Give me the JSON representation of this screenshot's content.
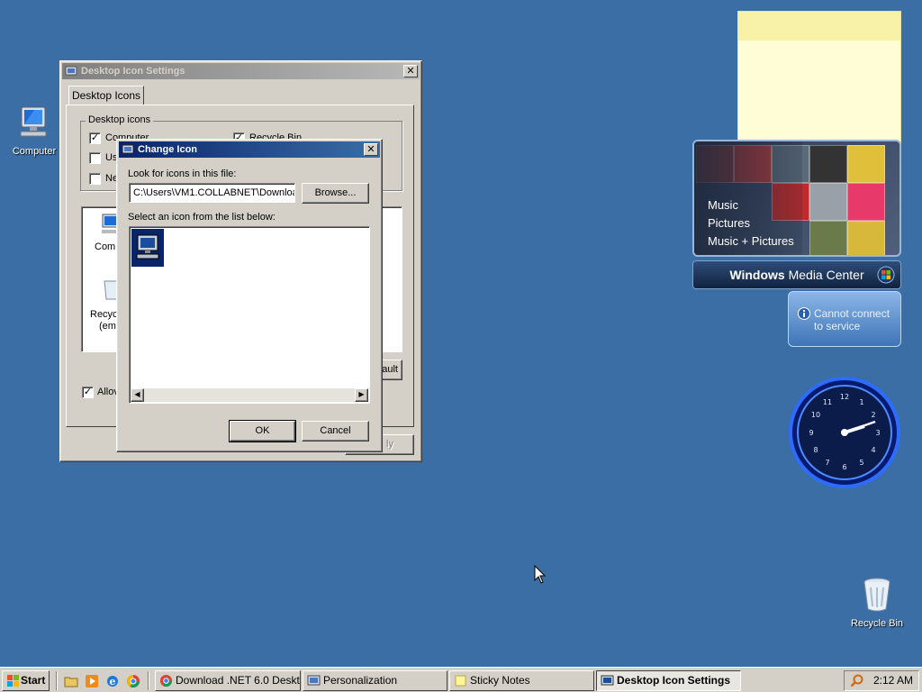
{
  "desktop": {
    "icons": [
      {
        "label": "Computer"
      },
      {
        "label": "Recycle Bin"
      }
    ]
  },
  "desktop_icon_settings": {
    "title": "Desktop Icon Settings",
    "tab": "Desktop Icons",
    "group_label": "Desktop icons",
    "checkboxes": [
      {
        "label": "Computer",
        "checked": true
      },
      {
        "label": "Us",
        "checked": false
      },
      {
        "label": "Ne",
        "checked": false
      },
      {
        "label": "Recycle Bin",
        "checked": true
      }
    ],
    "list_items": [
      {
        "label": "Comp"
      },
      {
        "label": "Recyc"
      },
      {
        "label": "(emp"
      }
    ],
    "restore_default_partial": "ault",
    "allow_partial": "Allov",
    "apply_partial": "ly"
  },
  "change_icon": {
    "title": "Change Icon",
    "look_label": "Look for icons in this file:",
    "path_value": "C:\\Users\\VM1.COLLABNET\\Download",
    "browse_label": "Browse...",
    "select_label": "Select an icon from the list below:",
    "ok_label": "OK",
    "cancel_label": "Cancel"
  },
  "media_center": {
    "menu": [
      "Music",
      "Pictures",
      "Music + Pictures"
    ],
    "brand_windows": "Windows",
    "brand_mc": "Media Center"
  },
  "weather": {
    "line1": "Cannot connect",
    "line2": "to service"
  },
  "taskbar": {
    "start_label": "Start",
    "tasks": [
      {
        "label": "Download .NET 6.0 Deskt..."
      },
      {
        "label": "Personalization"
      },
      {
        "label": "Sticky Notes"
      },
      {
        "label": "Desktop Icon Settings"
      }
    ],
    "clock": "2:12 AM"
  },
  "colors": {
    "desktop": "#3a6ea5",
    "title_active": "#0a246a",
    "title_inactive": "#808080",
    "selection": "#0a246a"
  }
}
